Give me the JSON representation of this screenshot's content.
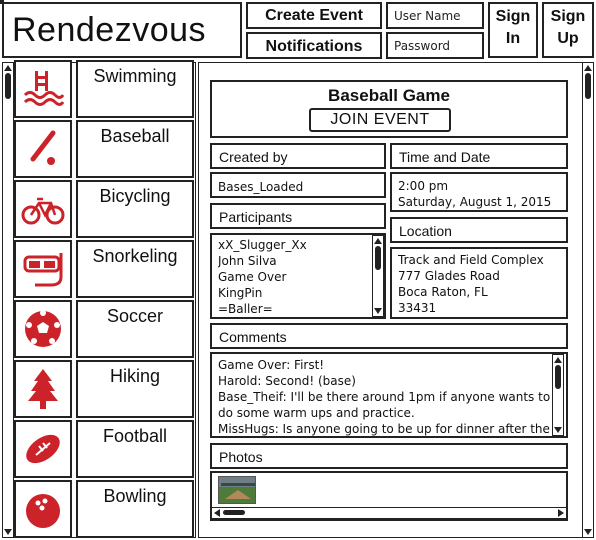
{
  "header": {
    "logo": "Rendezvous",
    "create_event": "Create Event",
    "notifications": "Notifications",
    "username_placeholder": "User Name",
    "password_placeholder": "Password",
    "sign_in": "Sign In",
    "sign_up": "Sign Up"
  },
  "sidebar": {
    "items": [
      {
        "label": "Swimming",
        "icon": "swimming-icon"
      },
      {
        "label": "Baseball",
        "icon": "baseball-icon"
      },
      {
        "label": "Bicycling",
        "icon": "bicycle-icon"
      },
      {
        "label": "Snorkeling",
        "icon": "snorkel-icon"
      },
      {
        "label": "Soccer",
        "icon": "soccer-ball-icon"
      },
      {
        "label": "Hiking",
        "icon": "tree-icon"
      },
      {
        "label": "Football",
        "icon": "football-icon"
      },
      {
        "label": "Bowling",
        "icon": "bowling-ball-icon"
      }
    ]
  },
  "event": {
    "title": "Baseball Game",
    "join_label": "JOIN EVENT",
    "created_by_label": "Created by",
    "created_by": "Bases_Loaded",
    "time_label": "Time and Date",
    "time": "2:00 pm",
    "date": "Saturday, August 1, 2015",
    "participants_label": "Participants",
    "participants": [
      "xX_Slugger_Xx",
      "John Silva",
      "Game Over",
      "KingPin",
      "=Baller="
    ],
    "location_label": "Location",
    "location": [
      "Track and Field Complex",
      "777 Glades Road",
      "Boca Raton, FL",
      "33431"
    ],
    "comments_label": "Comments",
    "comments": [
      "Game Over: First!",
      "Harold: Second! (base)",
      "Base_Theif: I'll be there around 1pm if anyone wants to",
      "do some warm ups and practice.",
      "MissHugs: Is anyone going to be up for dinner after the"
    ],
    "photos_label": "Photos"
  },
  "colors": {
    "icon_red": "#cc2229",
    "ink": "#222222"
  }
}
